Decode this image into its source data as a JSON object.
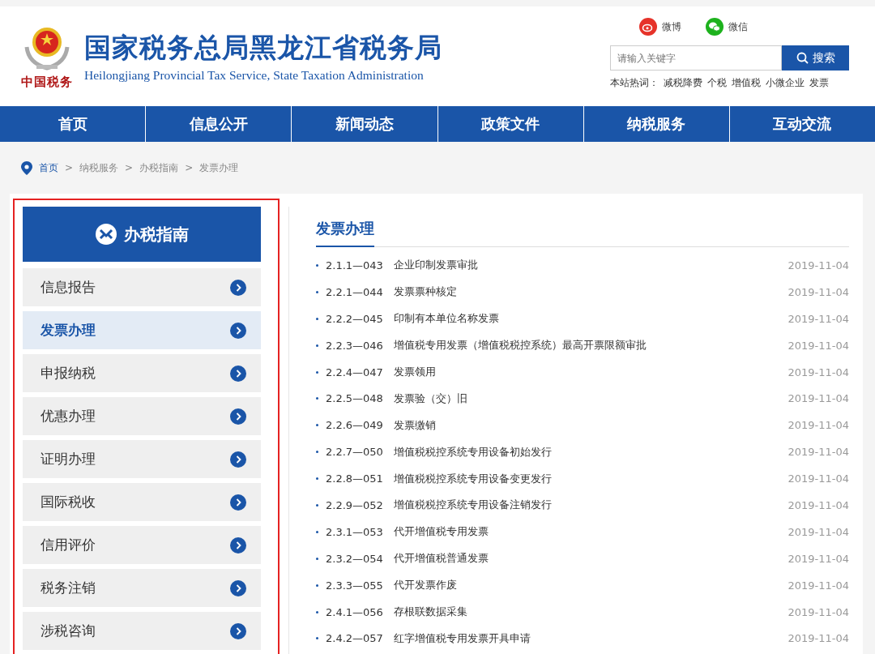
{
  "header": {
    "title": "国家税务总局黑龙江省税务局",
    "subtitle": "Heilongjiang Provincial Tax Service, State Taxation Administration",
    "emblem_caption": "中国税务",
    "social": [
      {
        "kind": "weibo",
        "label": "微博"
      },
      {
        "kind": "wechat",
        "label": "微信"
      }
    ],
    "search": {
      "placeholder": "请输入关键字",
      "button": "搜索"
    },
    "hot_label": "本站热词：",
    "hot_words": [
      "减税降费",
      "个税",
      "增值税",
      "小微企业",
      "发票"
    ]
  },
  "nav": [
    "首页",
    "信息公开",
    "新闻动态",
    "政策文件",
    "纳税服务",
    "互动交流"
  ],
  "breadcrumb": {
    "items": [
      "首页",
      "纳税服务",
      "办税指南",
      "发票办理"
    ],
    "separators": [
      ">",
      ">",
      ">"
    ]
  },
  "sidebar": {
    "title": "办税指南",
    "items": [
      {
        "label": "信息报告",
        "selected": false
      },
      {
        "label": "发票办理",
        "selected": true
      },
      {
        "label": "申报纳税",
        "selected": false
      },
      {
        "label": "优惠办理",
        "selected": false
      },
      {
        "label": "证明办理",
        "selected": false
      },
      {
        "label": "国际税收",
        "selected": false
      },
      {
        "label": "信用评价",
        "selected": false
      },
      {
        "label": "税务注销",
        "selected": false
      },
      {
        "label": "涉税咨询",
        "selected": false
      }
    ]
  },
  "list": {
    "title": "发票办理",
    "items": [
      {
        "code": "2.1.1—043",
        "title": "企业印制发票审批",
        "date": "2019-11-04"
      },
      {
        "code": "2.2.1—044",
        "title": "发票票种核定",
        "date": "2019-11-04"
      },
      {
        "code": "2.2.2—045",
        "title": "印制有本单位名称发票",
        "date": "2019-11-04"
      },
      {
        "code": "2.2.3—046",
        "title": "增值税专用发票（增值税税控系统）最高开票限额审批",
        "date": "2019-11-04"
      },
      {
        "code": "2.2.4—047",
        "title": "发票领用",
        "date": "2019-11-04"
      },
      {
        "code": "2.2.5—048",
        "title": "发票验（交）旧",
        "date": "2019-11-04"
      },
      {
        "code": "2.2.6—049",
        "title": "发票缴销",
        "date": "2019-11-04"
      },
      {
        "code": "2.2.7—050",
        "title": "增值税税控系统专用设备初始发行",
        "date": "2019-11-04"
      },
      {
        "code": "2.2.8—051",
        "title": "增值税税控系统专用设备变更发行",
        "date": "2019-11-04"
      },
      {
        "code": "2.2.9—052",
        "title": "增值税税控系统专用设备注销发行",
        "date": "2019-11-04"
      },
      {
        "code": "2.3.1—053",
        "title": "代开增值税专用发票",
        "date": "2019-11-04"
      },
      {
        "code": "2.3.2—054",
        "title": "代开增值税普通发票",
        "date": "2019-11-04"
      },
      {
        "code": "2.3.3—055",
        "title": "代开发票作废",
        "date": "2019-11-04"
      },
      {
        "code": "2.4.1—056",
        "title": "存根联数据采集",
        "date": "2019-11-04"
      },
      {
        "code": "2.4.2—057",
        "title": "红字增值税专用发票开具申请",
        "date": "2019-11-04"
      }
    ]
  }
}
